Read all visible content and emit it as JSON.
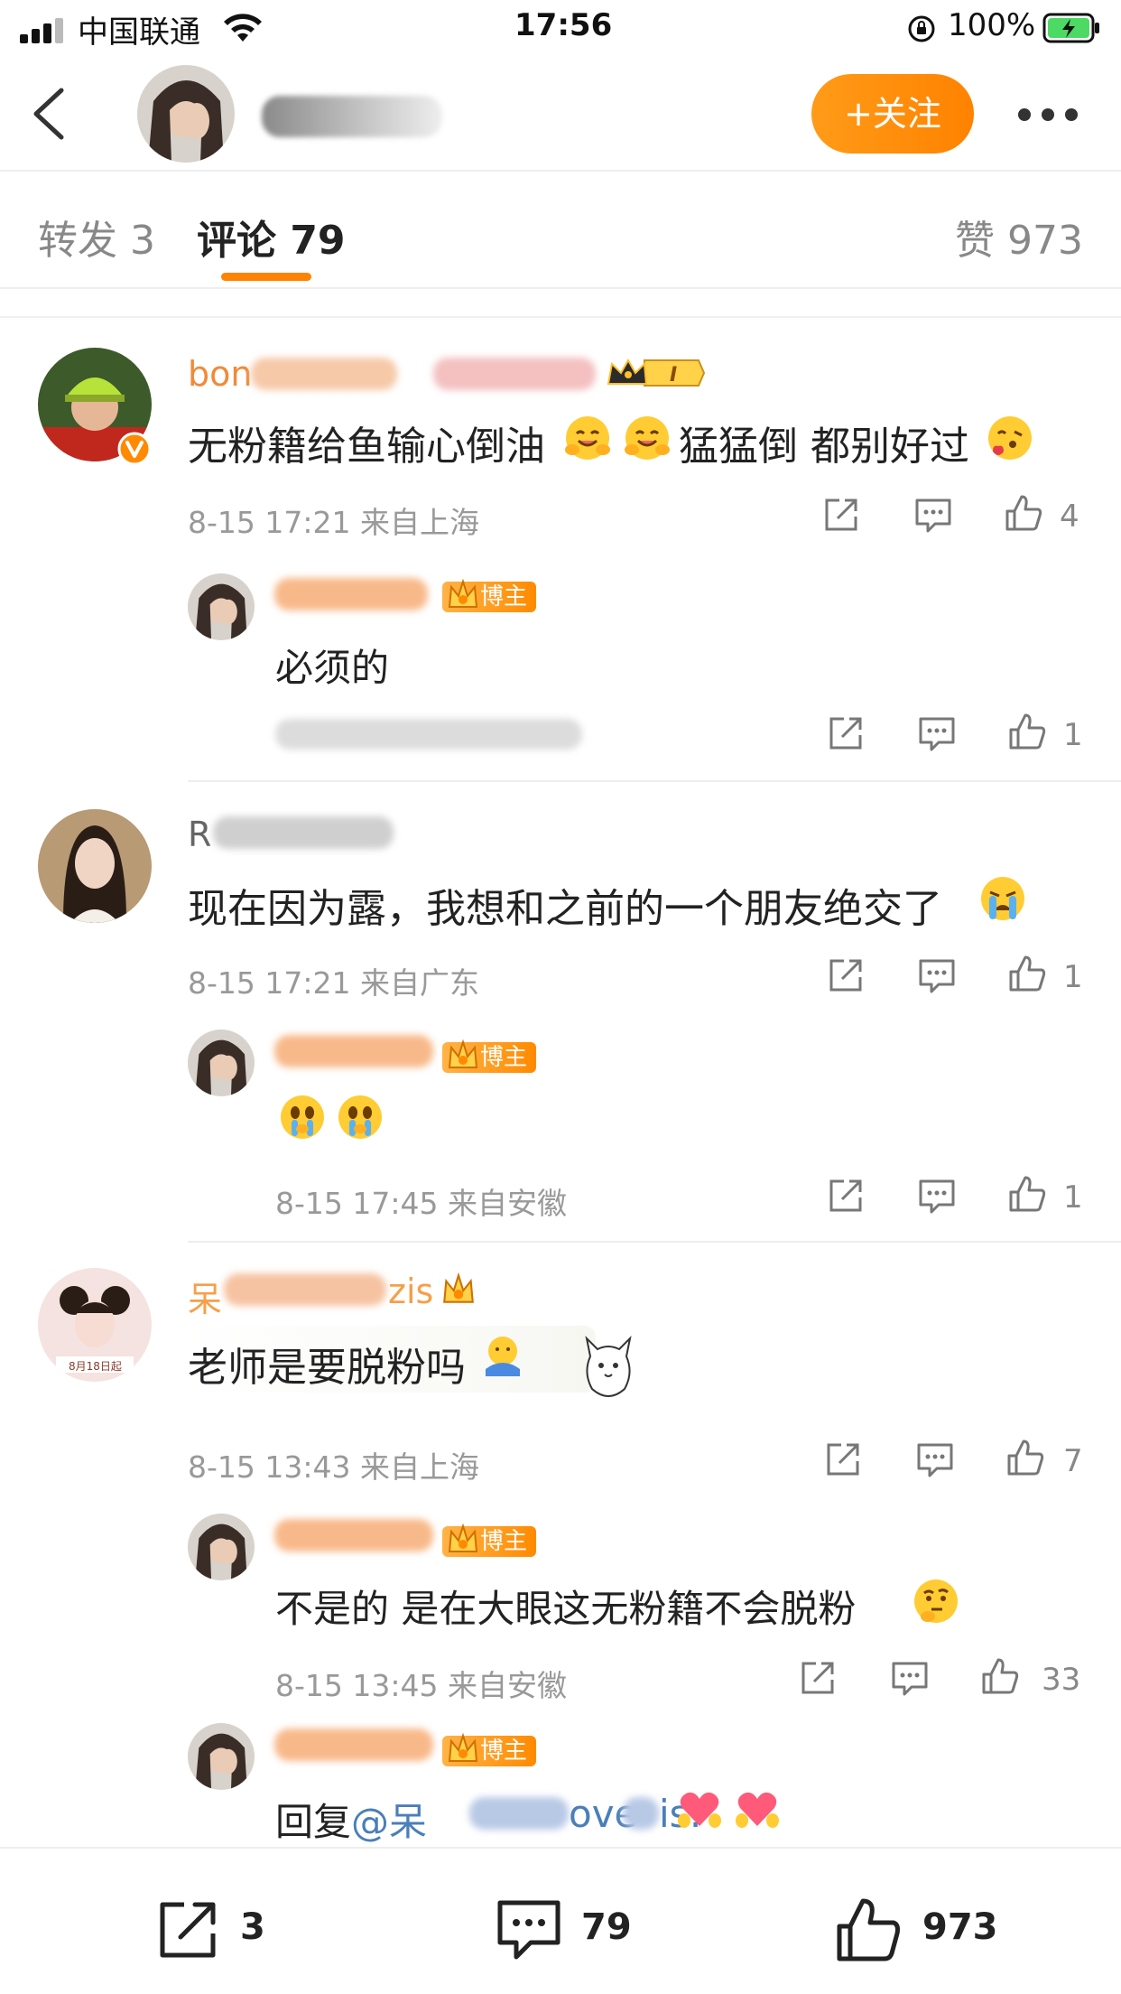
{
  "status_bar": {
    "carrier": "中国联通",
    "time": "17:56",
    "battery": "100%"
  },
  "nav": {
    "follow_label": "+关注"
  },
  "tabs": {
    "repost": "转发 3",
    "comments": "评论 79",
    "likes": "赞 973"
  },
  "comments": [
    {
      "username_visible": "bon",
      "text": "无粉籍给鱼输心倒油",
      "text_tail": "猛猛倒 都别好过",
      "vip_level": "I",
      "meta": "8-15 17:21 来自上海",
      "likes": "4",
      "reply": {
        "badge": "博主",
        "text": "必须的",
        "likes": "1"
      }
    },
    {
      "username_visible": "R",
      "text": "现在因为露，我想和之前的一个朋友绝交了",
      "meta": "8-15 17:21 来自广东",
      "likes": "1",
      "reply": {
        "badge": "博主",
        "meta": "8-15 17:45 来自安徽",
        "likes": "1"
      }
    },
    {
      "username_visible": "呆",
      "username_tail": "zis",
      "text": "老师是要脱粉吗",
      "avatar_caption": "8月18日起",
      "meta": "8-15 13:43 来自上海",
      "likes": "7",
      "replies": [
        {
          "badge": "博主",
          "text": "不是的 是在大眼这无粉籍不会脱粉",
          "meta": "8-15 13:45 来自安徽",
          "likes": "33"
        },
        {
          "badge": "博主",
          "prefix": "回复",
          "mention": "@呆",
          "mention_tail": "ove",
          "mention_end": "is:"
        }
      ]
    }
  ],
  "bottom_bar": {
    "reposts": "3",
    "comments": "79",
    "likes": "973"
  },
  "colors": {
    "accent": "#ff8200",
    "mention": "#4a7fb8",
    "meta": "#999999"
  }
}
